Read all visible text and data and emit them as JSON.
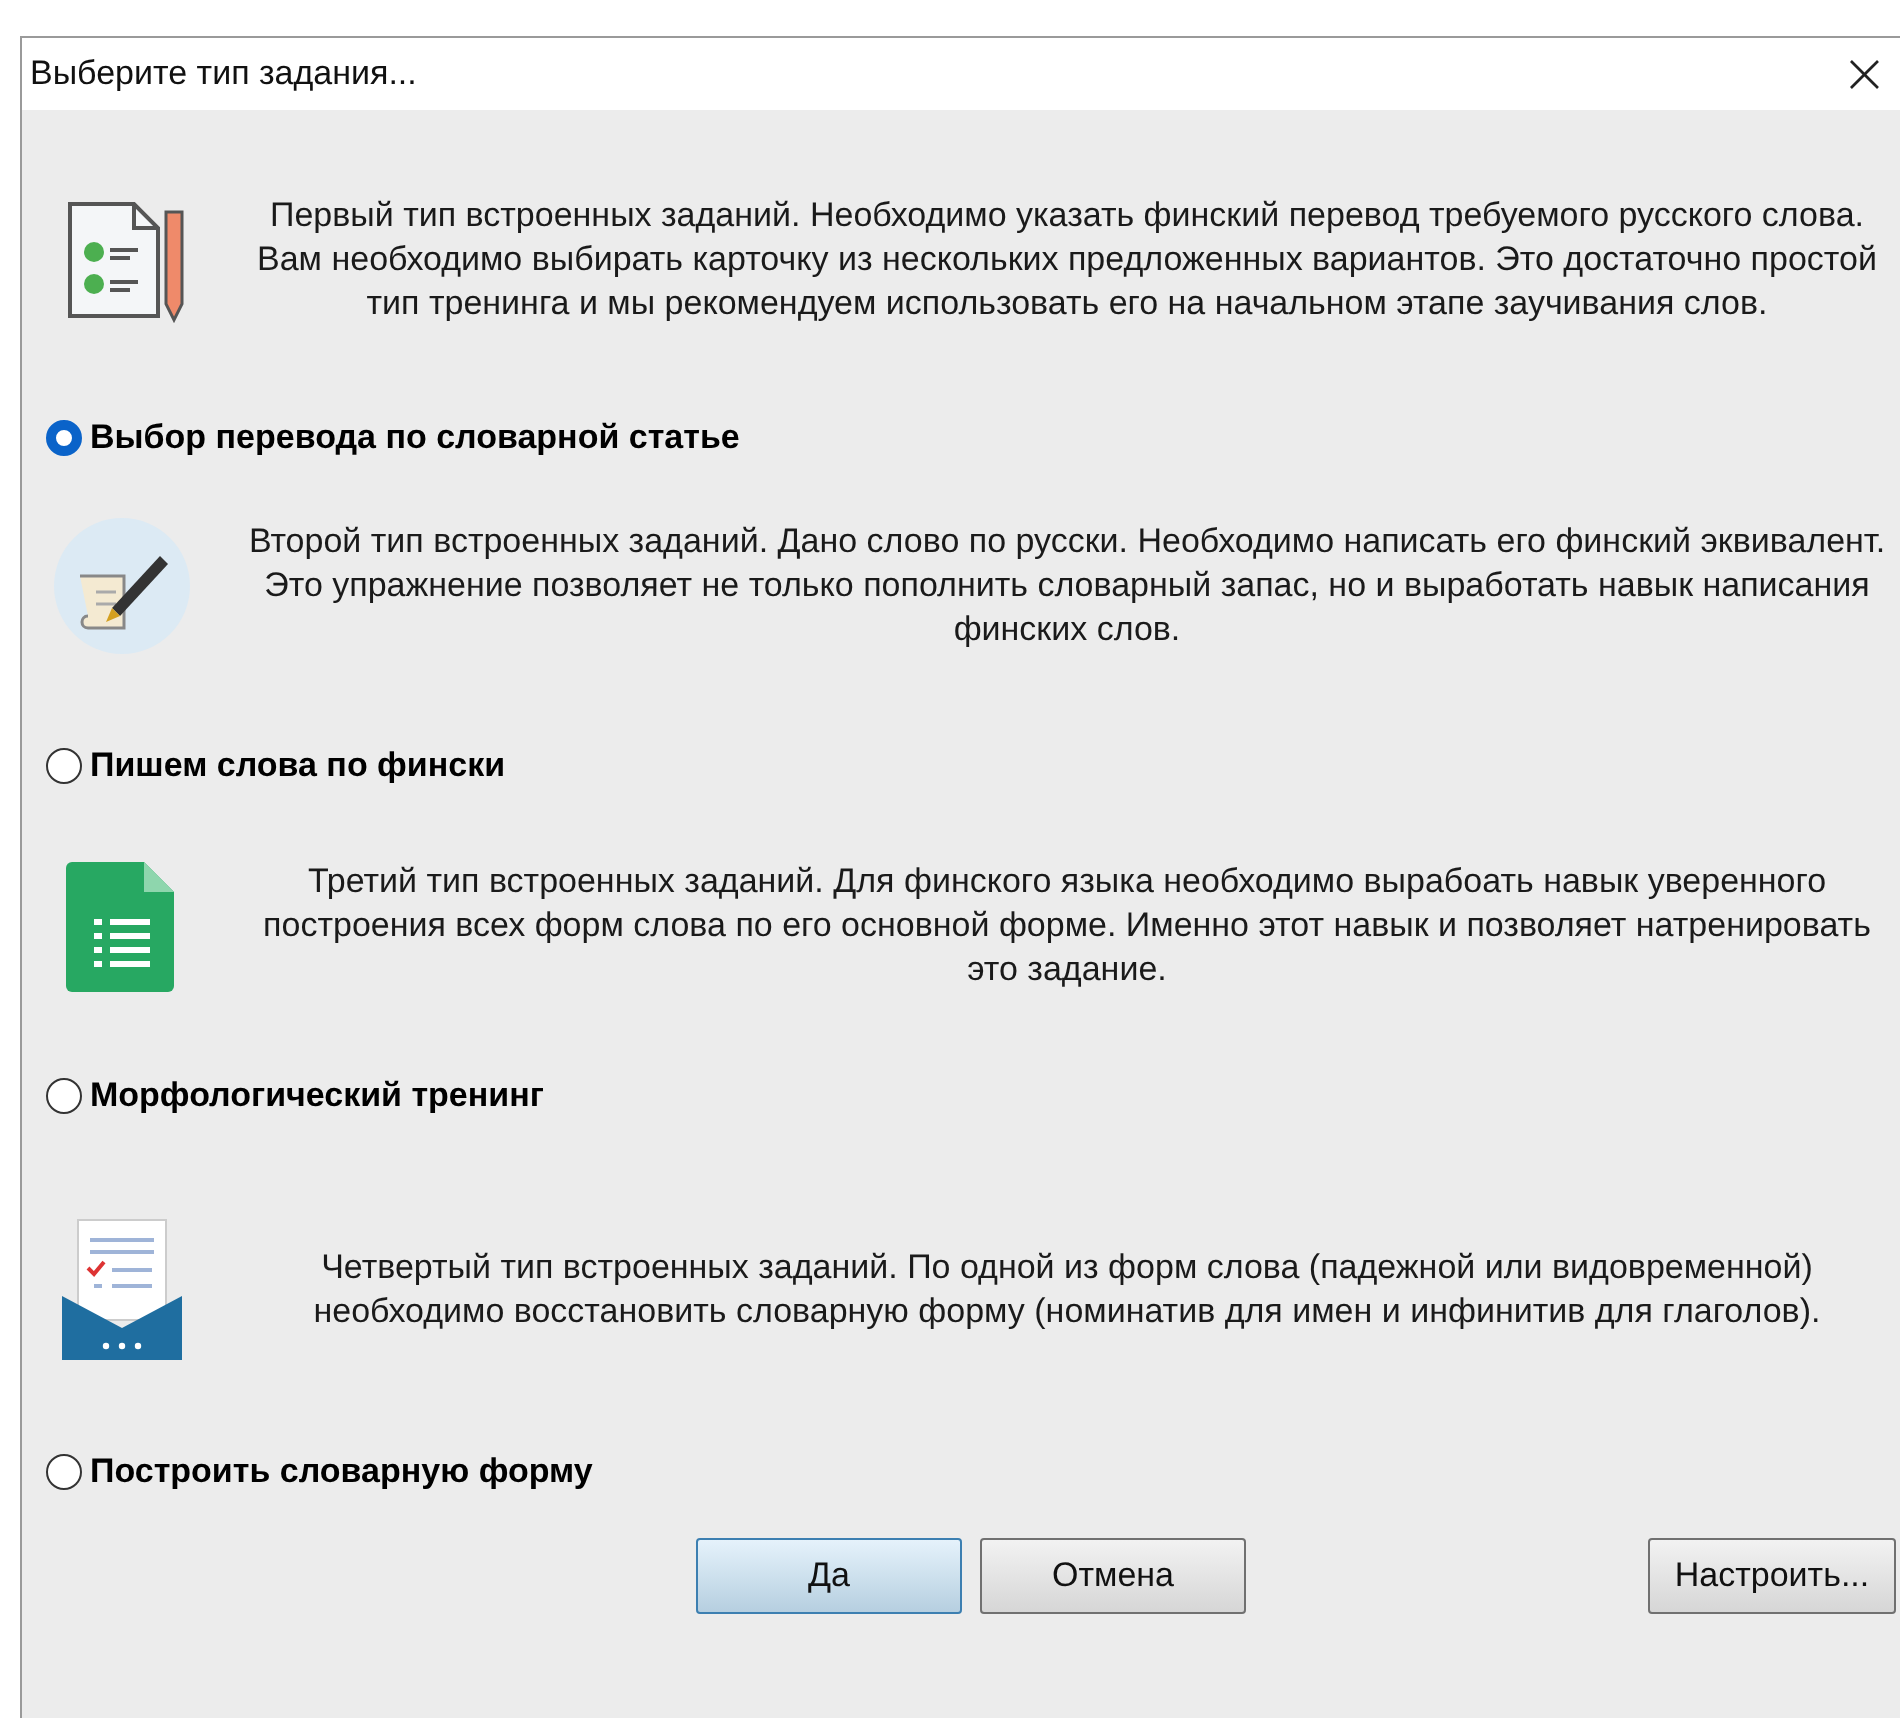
{
  "window": {
    "title": "Выберите тип задания...",
    "close": "×"
  },
  "options": [
    {
      "kind": "checklist",
      "description": "Первый тип встроенных заданий. Необходимо указать финский перевод требуемого русского слова. Вам необходимо выбирать карточку из нескольких предложенных вариантов. Это достаточно простой тип тренинга и мы рекомендуем использовать его на начальном этапе заучивания слов.",
      "label": "Выбор перевода по словарной статье",
      "selected": true
    },
    {
      "kind": "quill",
      "description": "Второй тип встроенных заданий. Дано слово по русски. Необходимо написать его финский эквивалент. Это упражнение позволяет не только пополнить словарный запас, но и выработать навык написания финских слов.",
      "label": "Пишем слова по фински",
      "selected": false
    },
    {
      "kind": "sheet",
      "description": "Третий тип встроенных заданий. Для финского языка необходимо вырабоать навык уверенного построения всех форм слова по его основной форме. Именно этот навык и позволяет натренировать это задание.",
      "label": "Морфологический тренинг",
      "selected": false
    },
    {
      "kind": "envelope",
      "description": "Четвертый тип встроенных заданий. По одной из форм слова (падежной или видовременной) необходимо восстановить словарную форму (номинатив для имен и инфинитив для глаголов).",
      "label": "Построить словарную форму",
      "selected": false
    }
  ],
  "buttons": [
    {
      "label": "Да",
      "kind": "default"
    },
    {
      "label": "Отмена",
      "kind": "normal"
    },
    {
      "label": "Настроить...",
      "kind": "side"
    }
  ]
}
